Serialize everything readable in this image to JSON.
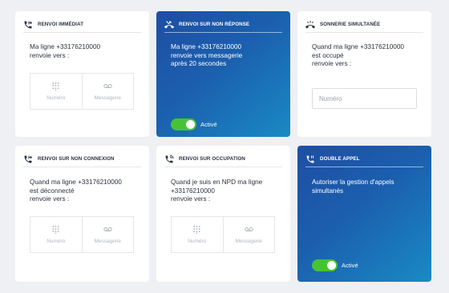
{
  "colors": {
    "card_blue_start": "#1f4ea3",
    "card_blue_end": "#1a8ac4",
    "toggle_on": "#46c335",
    "background": "#eef0f3"
  },
  "icons": {
    "phone_forward": "phone-forward-icon",
    "phone_missed": "phone-missed-icon",
    "phone_ring": "phone-ringing-icon",
    "keypad": "keypad-icon",
    "voicemail": "voicemail-icon"
  },
  "cards": {
    "immediate": {
      "title": "RENVOI IMMÉDIAT",
      "line1": "Ma ligne +33176210000",
      "line2": "renvoie vers :",
      "option_number": "Numéro",
      "option_voicemail": "Messagerie"
    },
    "no_answer": {
      "title": "RENVOI SUR NON RÉPONSE",
      "line1": "Ma ligne +33176210000",
      "line2": "renvoie vers messagerie",
      "line3": "après 20 secondes",
      "toggle_label": "Activé",
      "toggle_on": true
    },
    "simultaneous": {
      "title": "SONNERIE SIMULTANÉE",
      "line1": "Quand ma ligne +33176210000",
      "line2": "est occupé",
      "line3": "renvoie vers :",
      "input_placeholder": "Numéro"
    },
    "no_connection": {
      "title": "RENVOI SUR NON CONNEXION",
      "line1": "Quand ma ligne +33176210000",
      "line2": "est déconnecté",
      "line3": "renvoie vers :",
      "option_number": "Numéro",
      "option_voicemail": "Messagerie"
    },
    "busy": {
      "title": "RENVOI SUR OCCUPATION",
      "line1": "Quand je suis en NPD ma ligne",
      "line2": "+33176210000",
      "line3": "renvoie vers :",
      "option_number": "Numéro",
      "option_voicemail": "Messagerie"
    },
    "double_call": {
      "title": "DOUBLE APPEL",
      "line1": "Autoriser la gestion d'appels",
      "line2": "simultanés",
      "toggle_label": "Activé",
      "toggle_on": true
    }
  }
}
